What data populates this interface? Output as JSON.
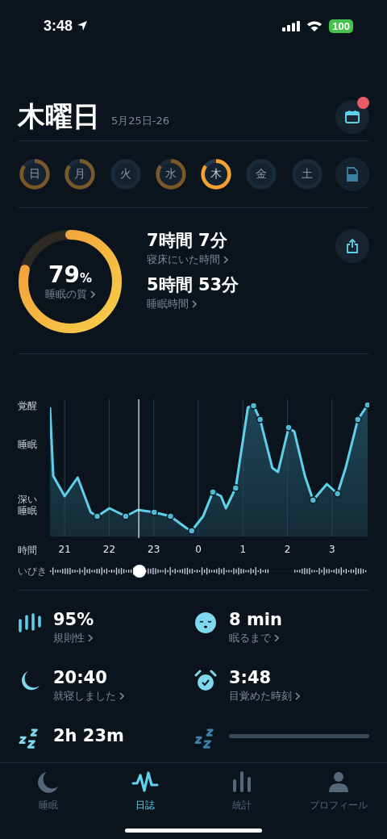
{
  "status_bar": {
    "time": "3:48",
    "battery": "100"
  },
  "header": {
    "title": "木曜日",
    "date_range": "5月25日-26",
    "calendar_badge": true
  },
  "days": [
    {
      "label": "日",
      "has_data": true,
      "selected": false
    },
    {
      "label": "月",
      "has_data": true,
      "selected": false
    },
    {
      "label": "火",
      "has_data": false,
      "selected": false
    },
    {
      "label": "水",
      "has_data": true,
      "selected": false
    },
    {
      "label": "木",
      "has_data": true,
      "selected": true
    },
    {
      "label": "金",
      "has_data": false,
      "selected": false
    },
    {
      "label": "土",
      "has_data": false,
      "selected": false
    }
  ],
  "score": {
    "value": "79",
    "unit": "%",
    "label": "睡眠の質"
  },
  "durations": [
    {
      "value": "7時間 7分",
      "label": "寝床にいた時間"
    },
    {
      "value": "5時間 53分",
      "label": "睡眠時間"
    }
  ],
  "hypnogram": {
    "y_labels": [
      "覚醒",
      "睡眠",
      "深い睡眠"
    ],
    "x_title": "時間",
    "x_ticks": [
      "21",
      "22",
      "23",
      "0",
      "1",
      "2",
      "3"
    ],
    "snore_label": "いびき"
  },
  "stats": [
    {
      "kind": "regularity",
      "value": "95%",
      "label": "規則性"
    },
    {
      "kind": "latency",
      "value": "8 min",
      "label": "眠るまで"
    },
    {
      "kind": "bedtime",
      "value": "20:40",
      "label": "就寝しました"
    },
    {
      "kind": "wake",
      "value": "3:48",
      "label": "目覚めた時刻"
    },
    {
      "kind": "snore",
      "value": "2h 23m"
    },
    {
      "kind": "snore_loading"
    }
  ],
  "tabs": [
    {
      "kind": "sleep",
      "label": "睡眠",
      "selected": false
    },
    {
      "kind": "journal",
      "label": "日誌",
      "selected": true
    },
    {
      "kind": "stats",
      "label": "統計",
      "selected": false
    },
    {
      "kind": "profile",
      "label": "プロフィール",
      "selected": false
    }
  ]
}
